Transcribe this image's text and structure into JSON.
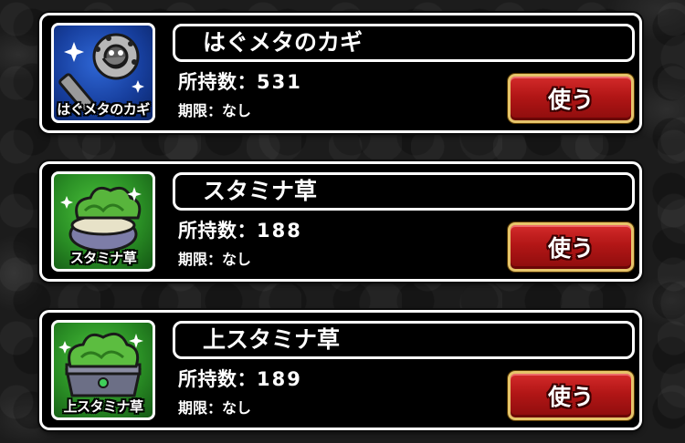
{
  "items": [
    {
      "name": "はぐメタのカギ",
      "icon_caption": "はぐメタのカギ",
      "icon": "key-icon",
      "count_label": "所持数：",
      "count": "531",
      "limit_label": "期限：なし",
      "use_label": "使う",
      "icon_bg": "#1f4fb8"
    },
    {
      "name": "スタミナ草",
      "icon_caption": "スタミナ草",
      "icon": "herb-pouch-icon",
      "count_label": "所持数：",
      "count": "188",
      "limit_label": "期限：なし",
      "use_label": "使う",
      "icon_bg": "#2f9a2a"
    },
    {
      "name": "上スタミナ草",
      "icon_caption": "上スタミナ草",
      "icon": "herb-crate-icon",
      "count_label": "所持数：",
      "count": "189",
      "limit_label": "期限：なし",
      "use_label": "使う",
      "icon_bg": "#2f9a2a"
    }
  ],
  "colors": {
    "button_red": "#c41e1e",
    "button_border_gold": "#e6c46a",
    "card_border": "#ffffff",
    "card_bg": "#000000"
  }
}
